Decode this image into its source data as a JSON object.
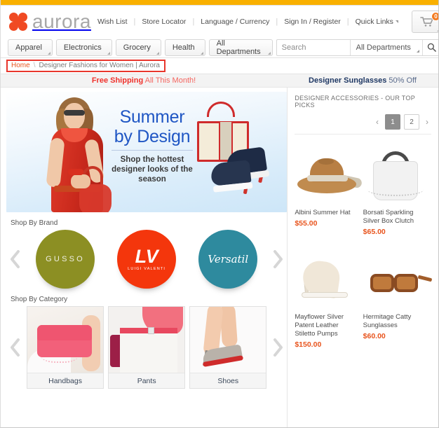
{
  "brand": {
    "name": "aurora",
    "logo_color": "#f04a23"
  },
  "header": {
    "links": [
      {
        "label": "Wish List",
        "caret": false
      },
      {
        "label": "Store Locator",
        "caret": false
      },
      {
        "label": "Language / Currency",
        "caret": false
      },
      {
        "label": "Sign In / Register",
        "caret": false
      },
      {
        "label": "Quick Links",
        "caret": true
      }
    ],
    "cart": {
      "icon": "shopping-cart-icon",
      "count": "0",
      "badge_color": "#f47b20"
    }
  },
  "nav": {
    "items": [
      "Apparel",
      "Electronics",
      "Grocery",
      "Health",
      "All Departments"
    ]
  },
  "search": {
    "placeholder": "Search",
    "value": "",
    "department": "All Departments",
    "button_icon": "search-icon"
  },
  "breadcrumb": {
    "home": "Home",
    "separator": "\\",
    "current": "Designer Fashions for Women | Aurora",
    "highlight_color": "#e8362c"
  },
  "promo": {
    "left_strong": "Free Shipping",
    "left_rest": " All This Month!",
    "right_strong": "Designer Sunglasses",
    "right_rest": " 50% Off"
  },
  "hero": {
    "title_line1": "Summer",
    "title_line2": "by Design",
    "subtitle": "Shop the hottest designer looks of the season",
    "title_color": "#1f56c4"
  },
  "shop_by_brand": {
    "label": "Shop By Brand",
    "prev_icon": "chevron-left-icon",
    "next_icon": "chevron-right-icon",
    "brands": [
      {
        "name": "GUSSO",
        "sub": "",
        "color": "#8c8f23"
      },
      {
        "name": "LV",
        "sub": "LUIGI VALENTI",
        "color": "#f4360c"
      },
      {
        "name": "Versatil",
        "sub": "",
        "color": "#2e8a9e"
      }
    ]
  },
  "shop_by_category": {
    "label": "Shop By Category",
    "prev_icon": "chevron-left-icon",
    "next_icon": "chevron-right-icon",
    "categories": [
      {
        "label": "Handbags"
      },
      {
        "label": "Pants"
      },
      {
        "label": "Shoes"
      }
    ]
  },
  "right_panel": {
    "title": "DESIGNER ACCESSORIES - OUR TOP PICKS",
    "pager": {
      "prev_icon": "chevron-left-icon",
      "next_icon": "chevron-right-icon",
      "pages": [
        "1",
        "2"
      ],
      "active": "1"
    },
    "products": [
      {
        "name": "Albini Summer Hat",
        "price": "$55.00"
      },
      {
        "name": "Borsati Sparkling Silver Box Clutch",
        "price": "$65.00"
      },
      {
        "name": "Mayflower Silver Patent Leather Stiletto Pumps",
        "price": "$150.00"
      },
      {
        "name": "Hermitage Catty Sunglasses",
        "price": "$60.00"
      }
    ]
  }
}
